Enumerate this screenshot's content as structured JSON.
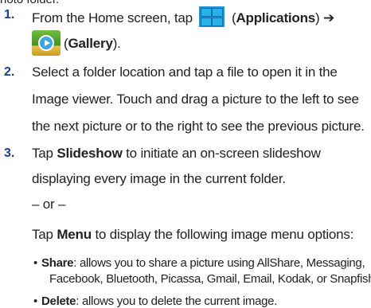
{
  "top_fragment": "hoto folder.",
  "steps": [
    {
      "number": "1.",
      "line1_pre": "From the Home screen, tap",
      "apps_label": "Applications",
      "arrow": "➔",
      "gallery_label": "Gallery"
    },
    {
      "number": "2.",
      "lines": [
        "Select a folder location and tap a file to open it in the",
        "Image viewer. Touch and drag a picture to the left to see",
        "the next picture or to the right to see the previous picture."
      ]
    },
    {
      "number": "3.",
      "line1_pre": "Tap",
      "slideshow": "Slideshow",
      "line1_post": "to initiate an on-screen slideshow",
      "line2": "displaying every image in the current folder.",
      "or": "– or –",
      "menu_pre": "Tap",
      "menu": "Menu",
      "menu_post": "to display the following image menu options:"
    }
  ],
  "bullets": [
    {
      "term": "Share",
      "text": ": allows you to share a picture using AllShare, Messaging,",
      "cont": "Facebook, Bluetooth, Picassa, Gmail,  Email, Kodak, or Snapfish."
    },
    {
      "term": "Delete",
      "text": ": allows you to delete the current image."
    }
  ],
  "colors": {
    "step_number": "#1a3f95",
    "apps_icon": "#1996d9"
  },
  "icons": [
    "applications-grid-icon",
    "gallery-icon"
  ]
}
